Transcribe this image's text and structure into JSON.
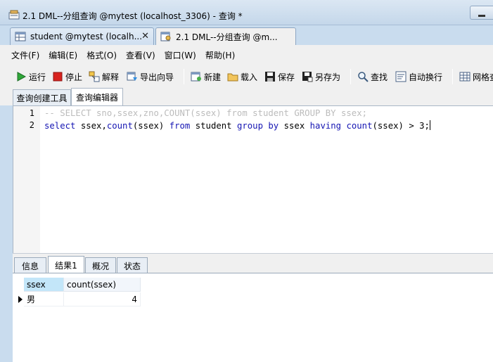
{
  "window": {
    "title": "2.1 DML--分组查询 @mytest (localhost_3306) - 查询 *"
  },
  "doc_tabs": [
    {
      "label": "student @mytest (localh...",
      "close": "✕"
    },
    {
      "label": "2.1 DML--分组查询 @m..."
    }
  ],
  "menu": [
    "文件(F)",
    "编辑(E)",
    "格式(O)",
    "查看(V)",
    "窗口(W)",
    "帮助(H)"
  ],
  "toolbar": {
    "run": "运行",
    "stop": "停止",
    "explain": "解释",
    "export": "导出向导",
    "new": "新建",
    "load": "载入",
    "save": "保存",
    "save_as": "另存为",
    "find": "查找",
    "wrap": "自动换行",
    "grid": "网格查看"
  },
  "sub_tabs": [
    "查询创建工具",
    "查询编辑器"
  ],
  "editor": {
    "lines": [
      {
        "no": "1",
        "text": "-- SELECT sno,ssex,zno,COUNT(ssex) from student GROUP BY ssex;"
      },
      {
        "no": "2",
        "tokens": [
          "select",
          " ssex,",
          "count",
          "(ssex) ",
          "from",
          " student ",
          "group",
          " ",
          "by",
          " ssex ",
          "having",
          " ",
          "count",
          "(ssex) > 3;"
        ]
      }
    ]
  },
  "result_tabs": [
    "信息",
    "结果1",
    "概况",
    "状态"
  ],
  "result": {
    "columns": [
      "ssex",
      "count(ssex)"
    ],
    "rows": [
      {
        "ssex": "男",
        "count": "4"
      }
    ]
  },
  "colors": {
    "keyword": "#1515b3",
    "comment": "#bcbcbc",
    "selected_header": "#c3e6f9"
  }
}
